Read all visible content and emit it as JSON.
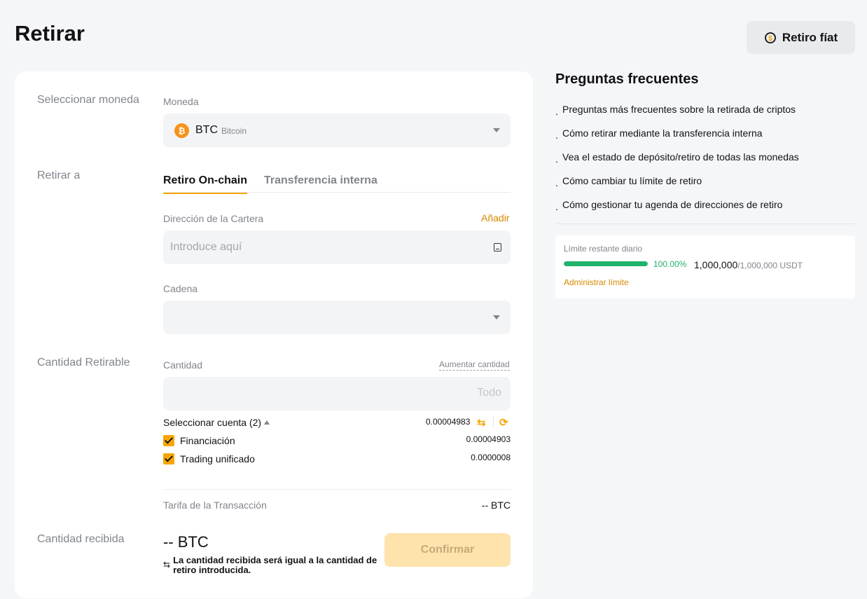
{
  "page": {
    "title": "Retirar"
  },
  "header": {
    "fiat_button": "Retiro fíat"
  },
  "form": {
    "select_coin_section": "Seleccionar moneda",
    "coin_label": "Moneda",
    "coin_symbol": "BTC",
    "coin_name": "Bitcoin",
    "withdraw_to_section": "Retirar a",
    "tabs": [
      {
        "label": "Retiro On-chain",
        "active": true
      },
      {
        "label": "Transferencia interna",
        "active": false
      }
    ],
    "wallet_label": "Dirección de la Cartera",
    "add_link": "Añadir",
    "address_placeholder": "Introduce aquí",
    "chain_label": "Cadena",
    "amount_section": "Cantidad Retirable",
    "amount_label": "Cantidad",
    "increase_link": "Aumentar cantidad",
    "all_button": "Todo",
    "select_account": "Seleccionar cuenta (2)",
    "total_balance": "0.00004983",
    "accounts": [
      {
        "label": "Financiación",
        "value": "0.00004903",
        "checked": true
      },
      {
        "label": "Trading unificado",
        "value": "0.0000008",
        "checked": true
      }
    ],
    "fee_label": "Tarifa de la Transacción",
    "fee_value": "-- BTC",
    "received_section": "Cantidad recibida",
    "received_amount": "-- BTC",
    "received_note": "La cantidad recibida será igual a la cantidad de retiro introducida.",
    "confirm_button": "Confirmar"
  },
  "faq": {
    "title": "Preguntas frecuentes",
    "items": [
      "Preguntas más frecuentes sobre la retirada de criptos",
      "Cómo retirar mediante la transferencia interna",
      "Vea el estado de depósito/retiro de todas las monedas",
      "Cómo cambiar tu límite de retiro",
      "Cómo gestionar tu agenda de direcciones de retiro"
    ]
  },
  "limit": {
    "label": "Límite restante diario",
    "percent": "100.00%",
    "fill_fraction": 1.0,
    "current": "1,000,000",
    "total": "/1,000,000 USDT",
    "manage_link": "Administrar límite"
  },
  "colors": {
    "accent": "#f7a600",
    "success": "#20b26c",
    "link": "#d68a00"
  }
}
